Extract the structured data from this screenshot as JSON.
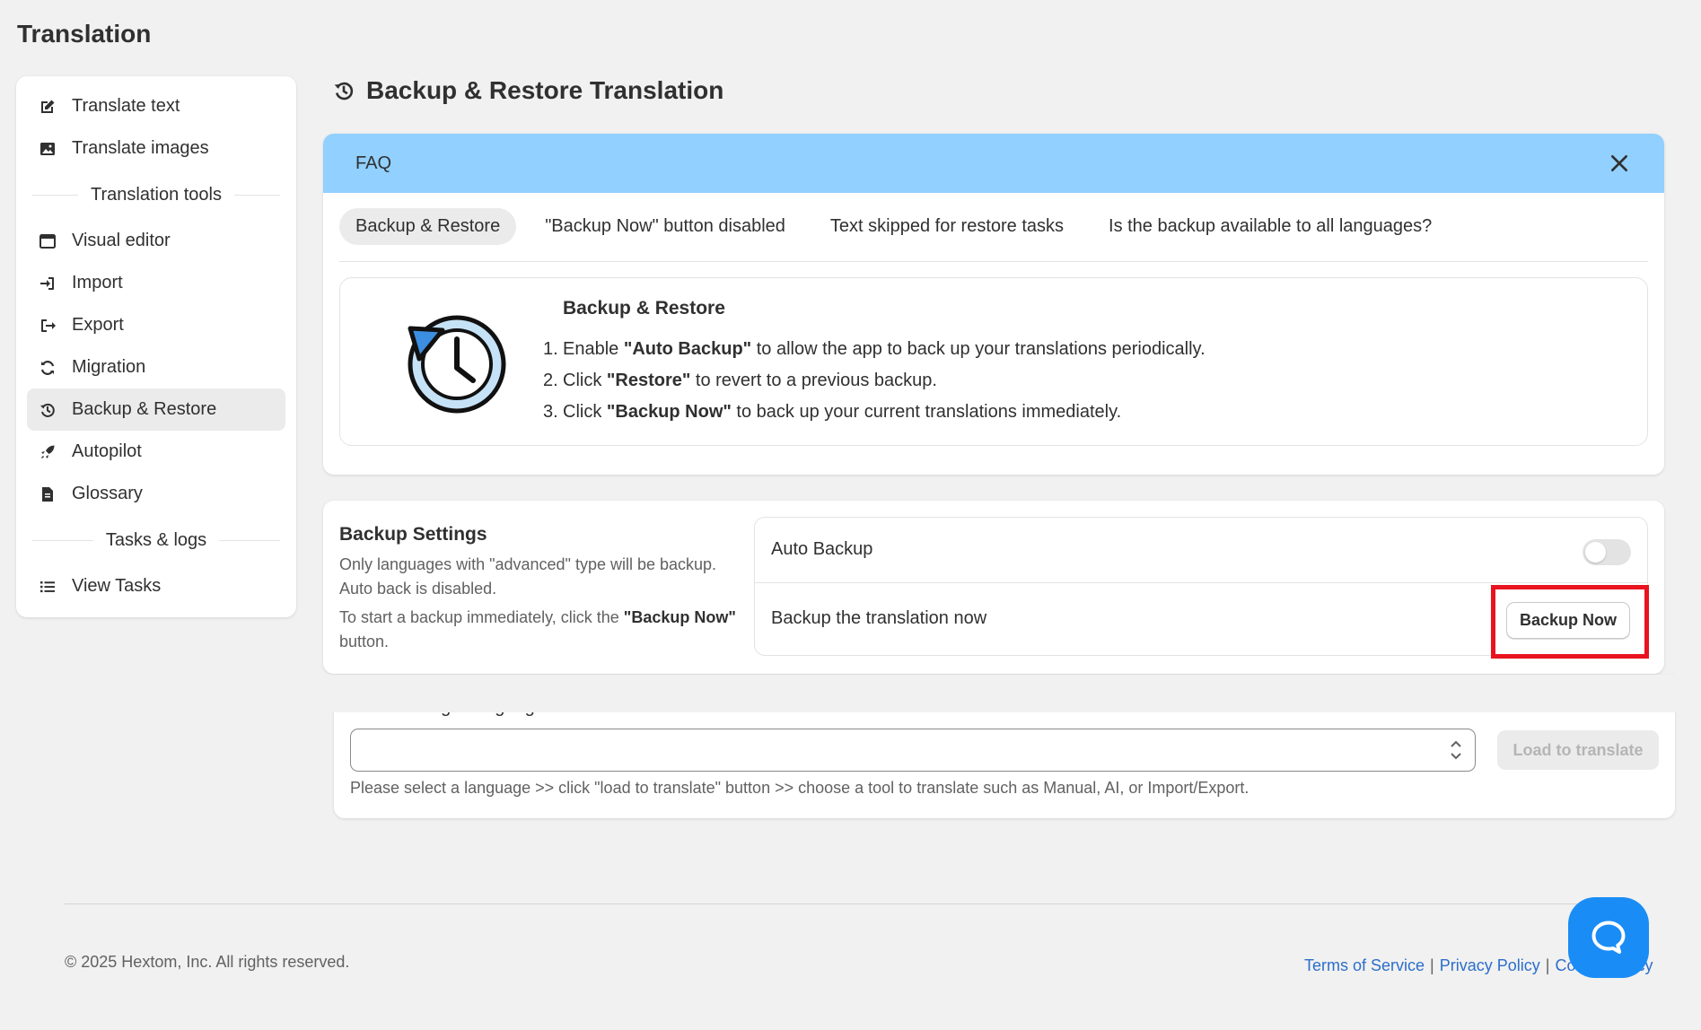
{
  "page": {
    "title": "Translation"
  },
  "sidebar": {
    "items": [
      {
        "label": "Translate text",
        "icon": "edit-icon"
      },
      {
        "label": "Translate images",
        "icon": "image-icon"
      }
    ],
    "section_tools": "Translation tools",
    "tools": [
      {
        "label": "Visual editor",
        "icon": "browser-window-icon"
      },
      {
        "label": "Import",
        "icon": "import-icon"
      },
      {
        "label": "Export",
        "icon": "export-icon"
      },
      {
        "label": "Migration",
        "icon": "sync-icon"
      },
      {
        "label": "Backup & Restore",
        "icon": "history-icon",
        "active": true
      },
      {
        "label": "Autopilot",
        "icon": "rocket-icon"
      },
      {
        "label": "Glossary",
        "icon": "document-icon"
      }
    ],
    "section_tasks": "Tasks & logs",
    "tasks": [
      {
        "label": "View Tasks",
        "icon": "list-icon"
      }
    ]
  },
  "main": {
    "title": "Backup & Restore Translation",
    "title_icon": "history-icon"
  },
  "faq": {
    "header": "FAQ",
    "tabs": [
      "Backup & Restore",
      "\"Backup Now\" button disabled",
      "Text skipped for restore tasks",
      "Is the backup available to all languages?"
    ],
    "active_tab": 0,
    "content_title": "Backup & Restore",
    "steps": [
      {
        "num": "1.",
        "before": "Enable ",
        "bold": "\"Auto Backup\"",
        "after": " to allow the app to back up your translations periodically."
      },
      {
        "num": "2.",
        "before": "Click ",
        "bold": "\"Restore\"",
        "after": " to revert to a previous backup."
      },
      {
        "num": "3.",
        "before": "Click ",
        "bold": "\"Backup Now\"",
        "after": " to back up your current translations immediately."
      }
    ]
  },
  "settings": {
    "title": "Backup Settings",
    "desc1": "Only languages with \"advanced\" type will be backup.",
    "desc2": "Auto back is disabled.",
    "desc3_before": "To start a backup immediately, click the ",
    "desc3_bold": "\"Backup Now\"",
    "desc3_after": " button.",
    "auto_backup_label": "Auto Backup",
    "auto_backup_enabled": false,
    "backup_now_label": "Backup the translation now",
    "backup_now_button": "Backup Now",
    "highlight_color": "#e8141f"
  },
  "language": {
    "label": "Select a target language",
    "selected": "",
    "load_button": "Load to translate",
    "help": "Please select a language >> click \"load to translate\" button >> choose a tool to translate such as Manual, AI, or Import/Export."
  },
  "footer": {
    "copyright": "© 2025 Hextom, Inc. All rights reserved.",
    "links": [
      "Terms of Service",
      "Privacy Policy",
      "Cookie Policy"
    ],
    "chat_icon": "chat-bubble-icon"
  },
  "colors": {
    "faq_header": "#91d0ff",
    "link": "#2c6ecb",
    "chat_button": "#1a8cf6"
  }
}
